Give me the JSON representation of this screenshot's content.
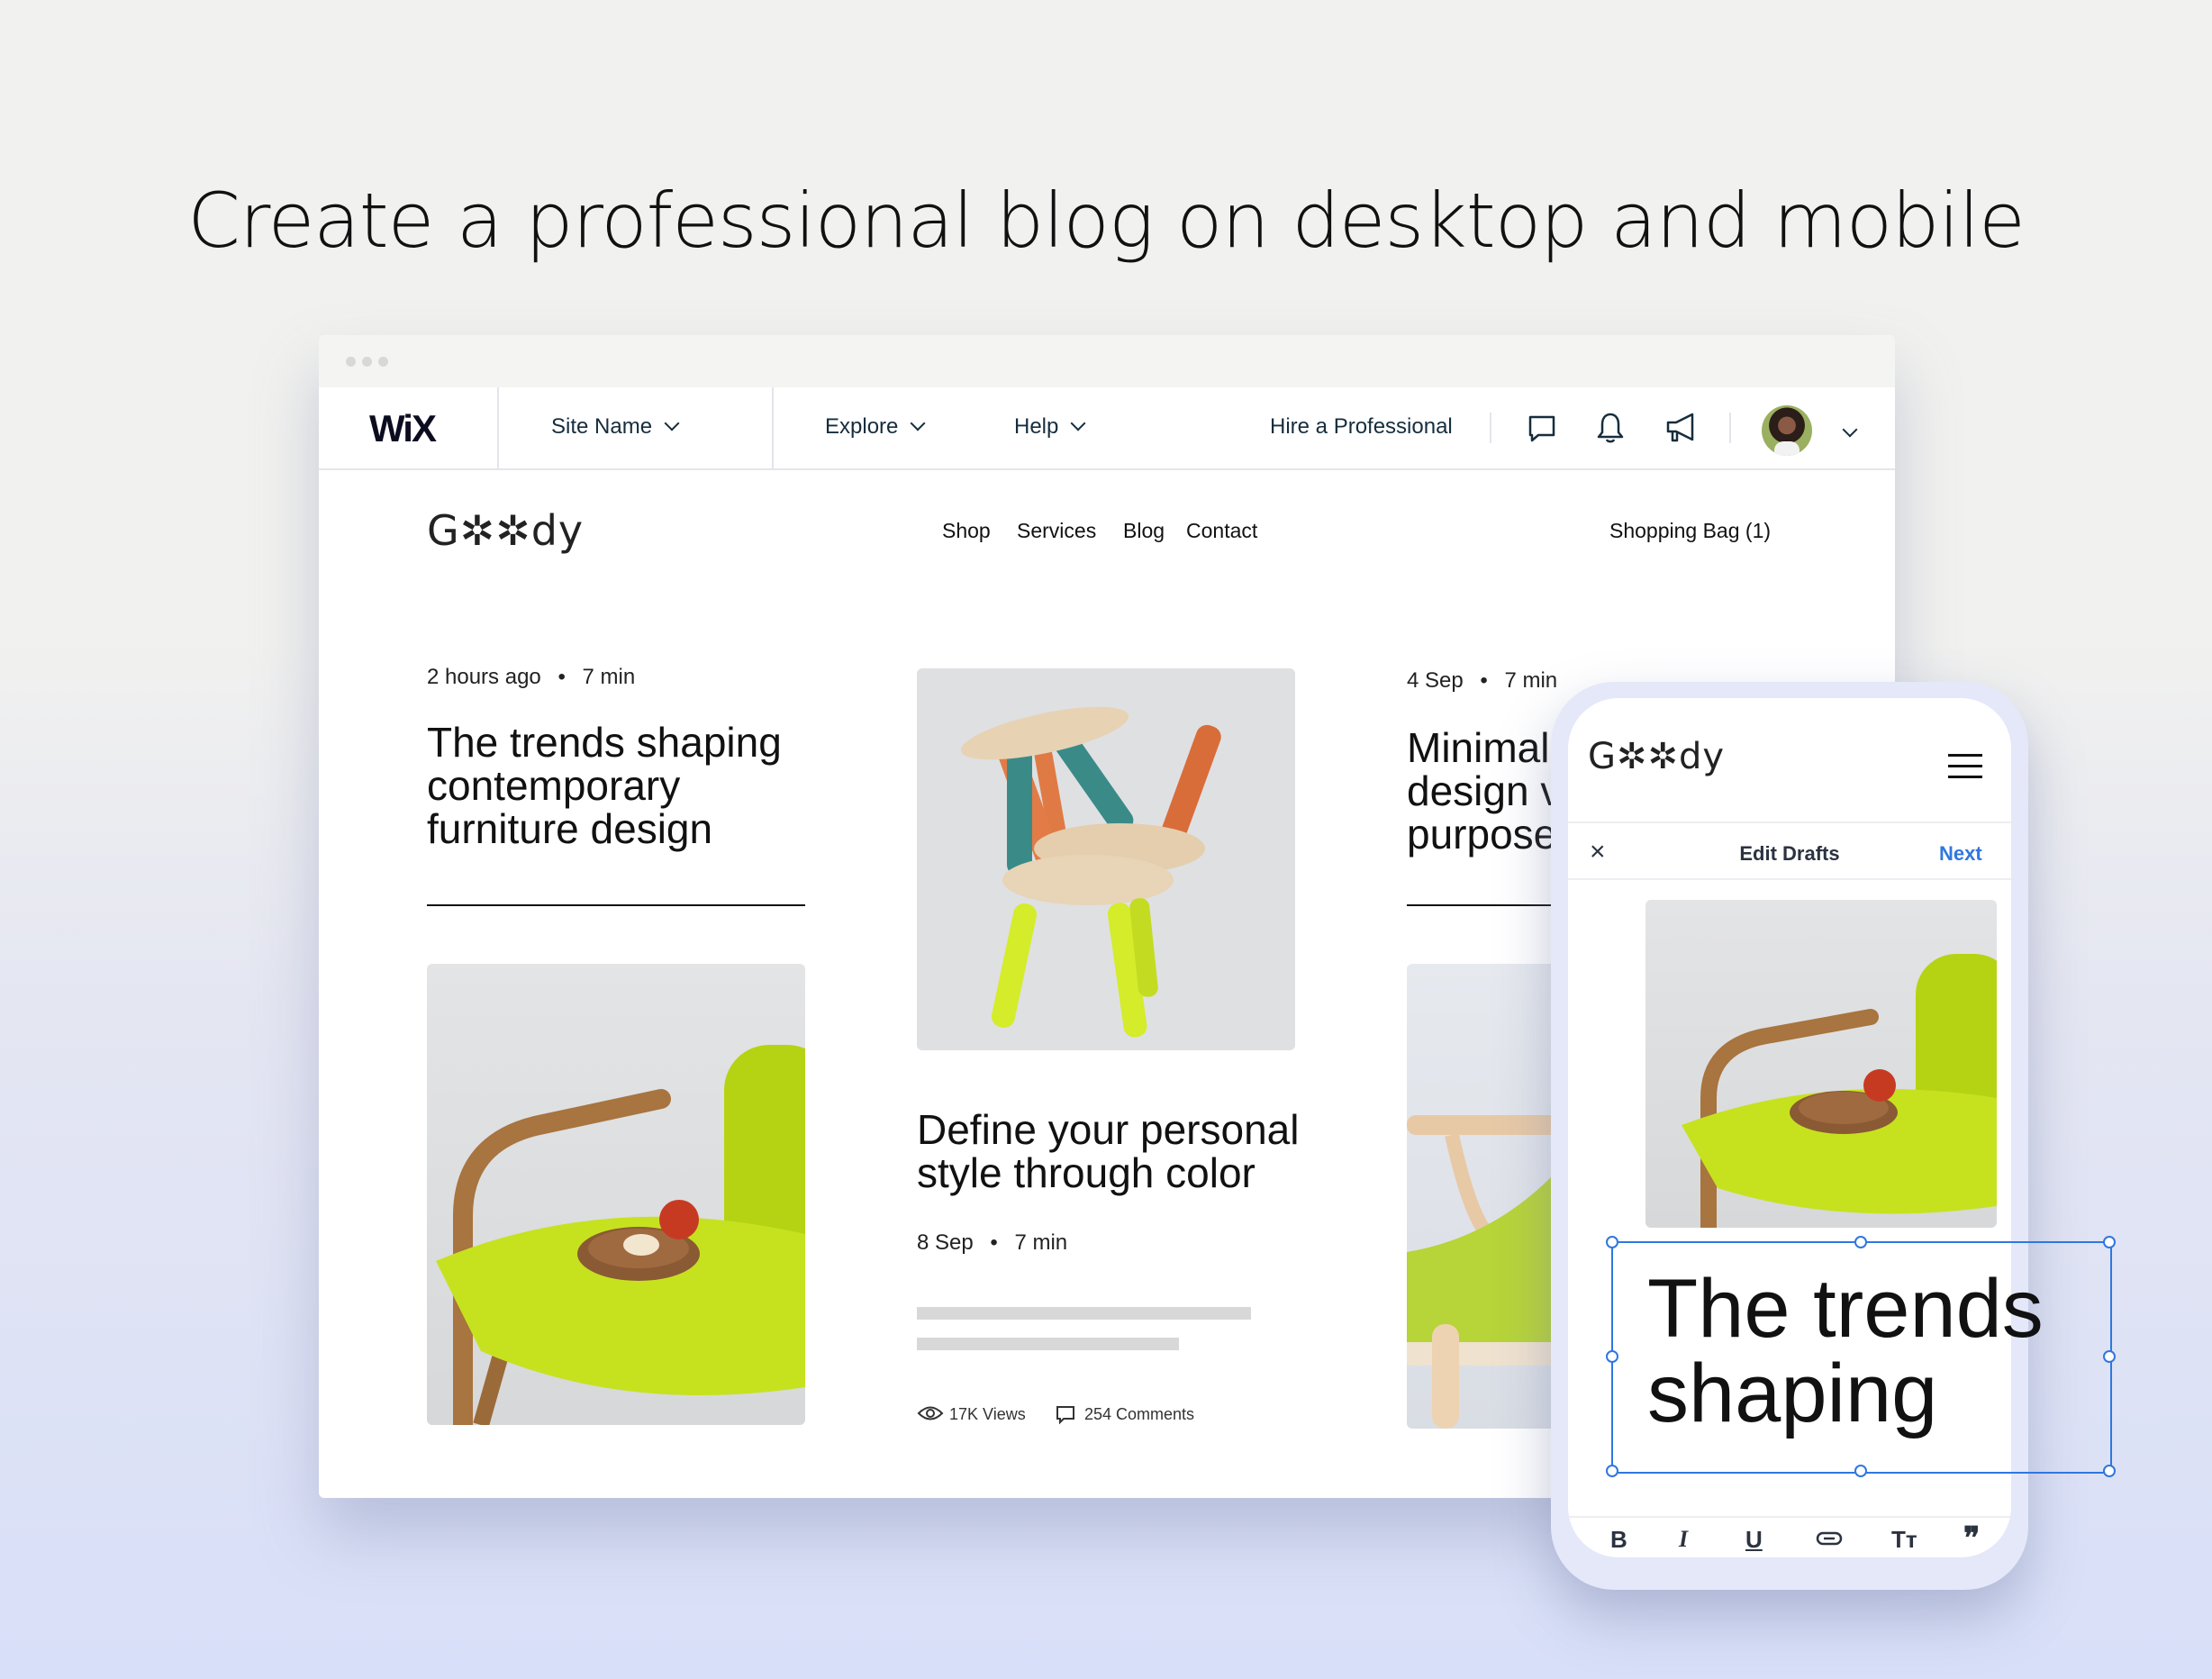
{
  "headline": "Create a professional blog on desktop and mobile",
  "editor_nav": {
    "logo": "WiX",
    "site_name": "Site Name",
    "explore": "Explore",
    "help": "Help",
    "hire": "Hire a Professional",
    "icons": [
      "chat-icon",
      "bell-icon",
      "megaphone-icon"
    ]
  },
  "site": {
    "logo": "G✲✲dy",
    "nav": [
      "Shop",
      "Services",
      "Blog",
      "Contact"
    ],
    "bag": "Shopping Bag (1)"
  },
  "posts": [
    {
      "date": "2 hours ago",
      "read": "7 min",
      "title_lines": [
        "The trends shaping",
        "contemporary",
        "furniture design"
      ]
    },
    {
      "date": "8 Sep",
      "read": "7 min",
      "title_lines": [
        "Define your personal",
        "style through color"
      ],
      "views": "17K Views",
      "comments": "254 Comments"
    },
    {
      "date": "4 Sep",
      "read": "7 min",
      "title_lines": [
        "Minimal",
        "design v",
        "purpose"
      ]
    }
  ],
  "separator": "•",
  "mobile": {
    "logo": "G✲✲dy",
    "close": "×",
    "title": "Edit Drafts",
    "next": "Next",
    "editing_text_lines": [
      "The trends",
      "shaping"
    ],
    "toolbar": [
      "B",
      "I",
      "U",
      "link",
      "Tт",
      "❞"
    ]
  },
  "colors": {
    "accent": "#2f77e0",
    "lime": "#c6e21f",
    "navy": "#162d3d"
  }
}
